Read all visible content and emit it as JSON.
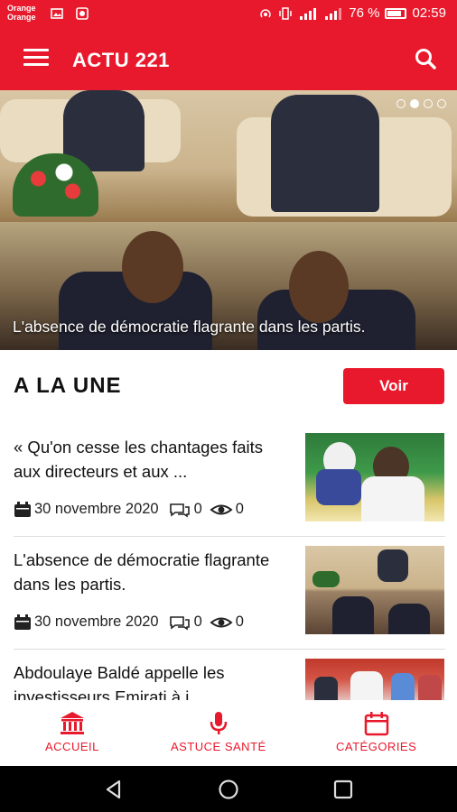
{
  "status_bar": {
    "carrier_1": "Orange",
    "carrier_2": "Orange",
    "battery": "76 %",
    "time": "02:59"
  },
  "app_bar": {
    "title": "ACTU 221",
    "menu_icon": "hamburger-menu-icon",
    "search_icon": "search-icon"
  },
  "carousel": {
    "caption": "L'absence de démocratie flagrante dans les partis.",
    "slide_count": 4,
    "active_index": 1
  },
  "section": {
    "title": "A LA UNE",
    "button_label": "Voir"
  },
  "articles": [
    {
      "title": "« Qu'on cesse les chantages faits aux directeurs et aux ...",
      "date": "30 novembre 2020",
      "comments": "0",
      "views": "0"
    },
    {
      "title": "L'absence de démocratie flagrante dans les partis.",
      "date": "30 novembre 2020",
      "comments": "0",
      "views": "0"
    },
    {
      "title": "Abdoulaye Baldé appelle les investisseurs Emirati à i..."
    }
  ],
  "bottom_nav": [
    {
      "label": "ACCUEIL",
      "icon": "bank-icon"
    },
    {
      "label": "ASTUCE SANTÉ",
      "icon": "microphone-icon"
    },
    {
      "label": "CATÉGORIES",
      "icon": "calendar-icon"
    }
  ],
  "colors": {
    "brand": "#e8192c",
    "text": "#111111"
  }
}
